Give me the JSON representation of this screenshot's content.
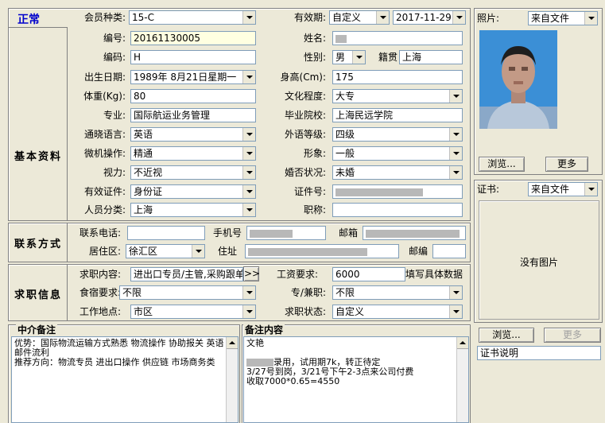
{
  "status_title": "正常",
  "sections": {
    "basic": "基本资料",
    "contact": "联系方式",
    "job": "求职信息"
  },
  "basic": {
    "member_type_label": "会员种类:",
    "member_type": "15-C",
    "validity_label": "有效期:",
    "validity_mode": "自定义",
    "validity_date": "2017-11-29",
    "number_label": "编号:",
    "number": "20161130005",
    "name_label": "姓名:",
    "code_label": "编码:",
    "code": "H",
    "gender_label": "性别:",
    "gender": "男",
    "native_label": "籍贯",
    "native": "上海",
    "birth_label": "出生日期:",
    "birth": "1989年 8月21日星期一",
    "height_label": "身高(Cm):",
    "height": "175",
    "weight_label": "体重(Kg):",
    "weight": "80",
    "edu_label": "文化程度:",
    "edu": "大专",
    "major_label": "专业:",
    "major": "国际航运业务管理",
    "school_label": "毕业院校:",
    "school": "上海民远学院",
    "lang_label": "通晓语言:",
    "lang": "英语",
    "lang_level_label": "外语等级:",
    "lang_level": "四级",
    "computer_label": "微机操作:",
    "computer": "精通",
    "appearance_label": "形象:",
    "appearance": "一般",
    "vision_label": "视力:",
    "vision": "不近视",
    "marital_label": "婚否状况:",
    "marital": "未婚",
    "id_type_label": "有效证件:",
    "id_type": "身份证",
    "id_no_label": "证件号:",
    "category_label": "人员分类:",
    "category": "上海",
    "title_label": "职称:",
    "title": ""
  },
  "contact": {
    "phone_label": "联系电话:",
    "phone": "",
    "mobile_label": "手机号",
    "email_label": "邮箱",
    "district_label": "居住区:",
    "district": "徐汇区",
    "address_label": "住址",
    "zip_label": "邮编",
    "zip": ""
  },
  "job": {
    "content_label": "求职内容:",
    "content": "进出口专员/主管,采购跟单",
    "more_btn": ">>",
    "salary_label": "工资要求:",
    "salary": "6000",
    "salary_hint": "填写具体数据",
    "housing_label": "食宿要求:",
    "housing": "不限",
    "parttime_label": "专/兼职:",
    "parttime": "不限",
    "location_label": "工作地点:",
    "location": "市区",
    "status_label": "求职状态:",
    "status": "自定义"
  },
  "agent_notes": {
    "title": "中介备注",
    "lines": [
      "优势：国际物流运输方式熟悉 物流操作 协助报关 英语邮件流利",
      "推荐方向：物流专员 进出口操作 供应链 市场商务类"
    ]
  },
  "remarks": {
    "title": "备注内容",
    "lines": [
      "文艳",
      "",
      "录用，试用期7k，转正待定",
      "3/27号到岗，3/21号下午2-3点来公司付费",
      "收取7000*0.65=4550"
    ]
  },
  "photo": {
    "label": "照片:",
    "source": "来自文件",
    "browse": "浏览...",
    "more": "更多"
  },
  "cert": {
    "label": "证书:",
    "source": "来自文件",
    "no_image": "没有图片",
    "browse": "浏览...",
    "more": "更多",
    "desc": "证书说明"
  }
}
